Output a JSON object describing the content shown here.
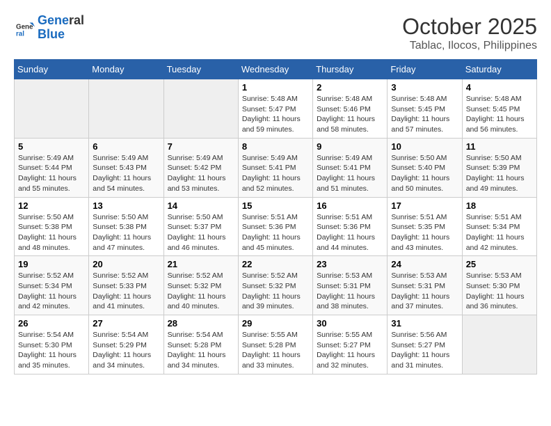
{
  "logo": {
    "line1": "General",
    "line2": "Blue"
  },
  "title": "October 2025",
  "subtitle": "Tablac, Ilocos, Philippines",
  "days_of_week": [
    "Sunday",
    "Monday",
    "Tuesday",
    "Wednesday",
    "Thursday",
    "Friday",
    "Saturday"
  ],
  "weeks": [
    [
      {
        "day": "",
        "info": ""
      },
      {
        "day": "",
        "info": ""
      },
      {
        "day": "",
        "info": ""
      },
      {
        "day": "1",
        "info": "Sunrise: 5:48 AM\nSunset: 5:47 PM\nDaylight: 11 hours\nand 59 minutes."
      },
      {
        "day": "2",
        "info": "Sunrise: 5:48 AM\nSunset: 5:46 PM\nDaylight: 11 hours\nand 58 minutes."
      },
      {
        "day": "3",
        "info": "Sunrise: 5:48 AM\nSunset: 5:45 PM\nDaylight: 11 hours\nand 57 minutes."
      },
      {
        "day": "4",
        "info": "Sunrise: 5:48 AM\nSunset: 5:45 PM\nDaylight: 11 hours\nand 56 minutes."
      }
    ],
    [
      {
        "day": "5",
        "info": "Sunrise: 5:49 AM\nSunset: 5:44 PM\nDaylight: 11 hours\nand 55 minutes."
      },
      {
        "day": "6",
        "info": "Sunrise: 5:49 AM\nSunset: 5:43 PM\nDaylight: 11 hours\nand 54 minutes."
      },
      {
        "day": "7",
        "info": "Sunrise: 5:49 AM\nSunset: 5:42 PM\nDaylight: 11 hours\nand 53 minutes."
      },
      {
        "day": "8",
        "info": "Sunrise: 5:49 AM\nSunset: 5:41 PM\nDaylight: 11 hours\nand 52 minutes."
      },
      {
        "day": "9",
        "info": "Sunrise: 5:49 AM\nSunset: 5:41 PM\nDaylight: 11 hours\nand 51 minutes."
      },
      {
        "day": "10",
        "info": "Sunrise: 5:50 AM\nSunset: 5:40 PM\nDaylight: 11 hours\nand 50 minutes."
      },
      {
        "day": "11",
        "info": "Sunrise: 5:50 AM\nSunset: 5:39 PM\nDaylight: 11 hours\nand 49 minutes."
      }
    ],
    [
      {
        "day": "12",
        "info": "Sunrise: 5:50 AM\nSunset: 5:38 PM\nDaylight: 11 hours\nand 48 minutes."
      },
      {
        "day": "13",
        "info": "Sunrise: 5:50 AM\nSunset: 5:38 PM\nDaylight: 11 hours\nand 47 minutes."
      },
      {
        "day": "14",
        "info": "Sunrise: 5:50 AM\nSunset: 5:37 PM\nDaylight: 11 hours\nand 46 minutes."
      },
      {
        "day": "15",
        "info": "Sunrise: 5:51 AM\nSunset: 5:36 PM\nDaylight: 11 hours\nand 45 minutes."
      },
      {
        "day": "16",
        "info": "Sunrise: 5:51 AM\nSunset: 5:36 PM\nDaylight: 11 hours\nand 44 minutes."
      },
      {
        "day": "17",
        "info": "Sunrise: 5:51 AM\nSunset: 5:35 PM\nDaylight: 11 hours\nand 43 minutes."
      },
      {
        "day": "18",
        "info": "Sunrise: 5:51 AM\nSunset: 5:34 PM\nDaylight: 11 hours\nand 42 minutes."
      }
    ],
    [
      {
        "day": "19",
        "info": "Sunrise: 5:52 AM\nSunset: 5:34 PM\nDaylight: 11 hours\nand 42 minutes."
      },
      {
        "day": "20",
        "info": "Sunrise: 5:52 AM\nSunset: 5:33 PM\nDaylight: 11 hours\nand 41 minutes."
      },
      {
        "day": "21",
        "info": "Sunrise: 5:52 AM\nSunset: 5:32 PM\nDaylight: 11 hours\nand 40 minutes."
      },
      {
        "day": "22",
        "info": "Sunrise: 5:52 AM\nSunset: 5:32 PM\nDaylight: 11 hours\nand 39 minutes."
      },
      {
        "day": "23",
        "info": "Sunrise: 5:53 AM\nSunset: 5:31 PM\nDaylight: 11 hours\nand 38 minutes."
      },
      {
        "day": "24",
        "info": "Sunrise: 5:53 AM\nSunset: 5:31 PM\nDaylight: 11 hours\nand 37 minutes."
      },
      {
        "day": "25",
        "info": "Sunrise: 5:53 AM\nSunset: 5:30 PM\nDaylight: 11 hours\nand 36 minutes."
      }
    ],
    [
      {
        "day": "26",
        "info": "Sunrise: 5:54 AM\nSunset: 5:30 PM\nDaylight: 11 hours\nand 35 minutes."
      },
      {
        "day": "27",
        "info": "Sunrise: 5:54 AM\nSunset: 5:29 PM\nDaylight: 11 hours\nand 34 minutes."
      },
      {
        "day": "28",
        "info": "Sunrise: 5:54 AM\nSunset: 5:28 PM\nDaylight: 11 hours\nand 34 minutes."
      },
      {
        "day": "29",
        "info": "Sunrise: 5:55 AM\nSunset: 5:28 PM\nDaylight: 11 hours\nand 33 minutes."
      },
      {
        "day": "30",
        "info": "Sunrise: 5:55 AM\nSunset: 5:27 PM\nDaylight: 11 hours\nand 32 minutes."
      },
      {
        "day": "31",
        "info": "Sunrise: 5:56 AM\nSunset: 5:27 PM\nDaylight: 11 hours\nand 31 minutes."
      },
      {
        "day": "",
        "info": ""
      }
    ]
  ]
}
